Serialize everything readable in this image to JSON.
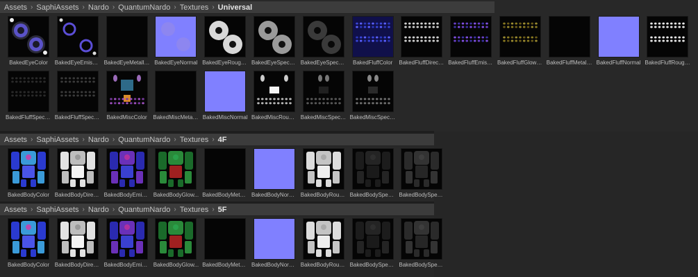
{
  "sections": [
    {
      "breadcrumb": [
        "Assets",
        "SaphiAssets",
        "Nardo",
        "QuantumNardo",
        "Textures",
        "Universal"
      ],
      "tiles": [
        {
          "label": "BakedEyeColor",
          "type": "eye-color"
        },
        {
          "label": "BakedEyeEmission",
          "type": "eye-emission"
        },
        {
          "label": "BakedEyeMetalli...",
          "type": "black"
        },
        {
          "label": "BakedEyeNormal",
          "type": "eye-normal"
        },
        {
          "label": "BakedEyeRoughn...",
          "type": "eye-rough"
        },
        {
          "label": "BakedEyeSpecular",
          "type": "eye-spec"
        },
        {
          "label": "BakedEyeSpecula...",
          "type": "eye-spec2"
        },
        {
          "label": "BakedFluffColor",
          "type": "fluff-color"
        },
        {
          "label": "BakedFluffDirecti...",
          "type": "fluff-dir"
        },
        {
          "label": "BakedFluffEmissi...",
          "type": "fluff-emis"
        },
        {
          "label": "BakedFluffGlowM...",
          "type": "fluff-glow"
        },
        {
          "label": "BakedFluffMetalli...",
          "type": "black"
        },
        {
          "label": "BakedFluffNormal",
          "type": "normal"
        },
        {
          "label": "BakedFluffRoughn...",
          "type": "fluff-rough"
        },
        {
          "label": "BakedFluffSpecul...",
          "type": "fluff-spec"
        },
        {
          "label": "BakedFluffSpecul...",
          "type": "fluff-spec2"
        },
        {
          "label": "BakedMiscColor",
          "type": "misc-color"
        },
        {
          "label": "BakedMiscMetalli...",
          "type": "black"
        },
        {
          "label": "BakedMiscNormal",
          "type": "normal"
        },
        {
          "label": "BakedMiscRough...",
          "type": "misc-rough"
        },
        {
          "label": "BakedMiscSpecul...",
          "type": "misc-spec"
        },
        {
          "label": "BakedMiscSpecul...",
          "type": "misc-spec2"
        }
      ]
    },
    {
      "breadcrumb": [
        "Assets",
        "SaphiAssets",
        "Nardo",
        "QuantumNardo",
        "Textures",
        "4F"
      ],
      "tiles": [
        {
          "label": "BakedBodyColor",
          "type": "body-color"
        },
        {
          "label": "BakedBodyDirect...",
          "type": "body-dir"
        },
        {
          "label": "BakedBodyEmissi...",
          "type": "body-emis"
        },
        {
          "label": "BakedBodyGlow...",
          "type": "body-glow"
        },
        {
          "label": "BakedBodyMetall...",
          "type": "black"
        },
        {
          "label": "BakedBodyNormal",
          "type": "normal"
        },
        {
          "label": "BakedBodyRough...",
          "type": "body-rough"
        },
        {
          "label": "BakedBodySpecu...",
          "type": "body-spec"
        },
        {
          "label": "BakedBodySpecu...",
          "type": "body-spec2"
        }
      ]
    },
    {
      "breadcrumb": [
        "Assets",
        "SaphiAssets",
        "Nardo",
        "QuantumNardo",
        "Textures",
        "5F"
      ],
      "tiles": [
        {
          "label": "BakedBodyColor",
          "type": "body-color"
        },
        {
          "label": "BakedBodyDirect...",
          "type": "body-dir"
        },
        {
          "label": "BakedBodyEmissi...",
          "type": "body-emis"
        },
        {
          "label": "BakedBodyGlow...",
          "type": "body-glow"
        },
        {
          "label": "BakedBodyMetall...",
          "type": "black"
        },
        {
          "label": "BakedBodyNormal",
          "type": "normal"
        },
        {
          "label": "BakedBodyRough...",
          "type": "body-rough"
        },
        {
          "label": "BakedBodySpecu...",
          "type": "body-spec"
        },
        {
          "label": "BakedBodySpecu...",
          "type": "body-spec2"
        }
      ]
    }
  ],
  "colors": {
    "normal": "#8080ff",
    "panel_bg": "#282828",
    "breadcrumb_bg": "#3c3c3c"
  }
}
